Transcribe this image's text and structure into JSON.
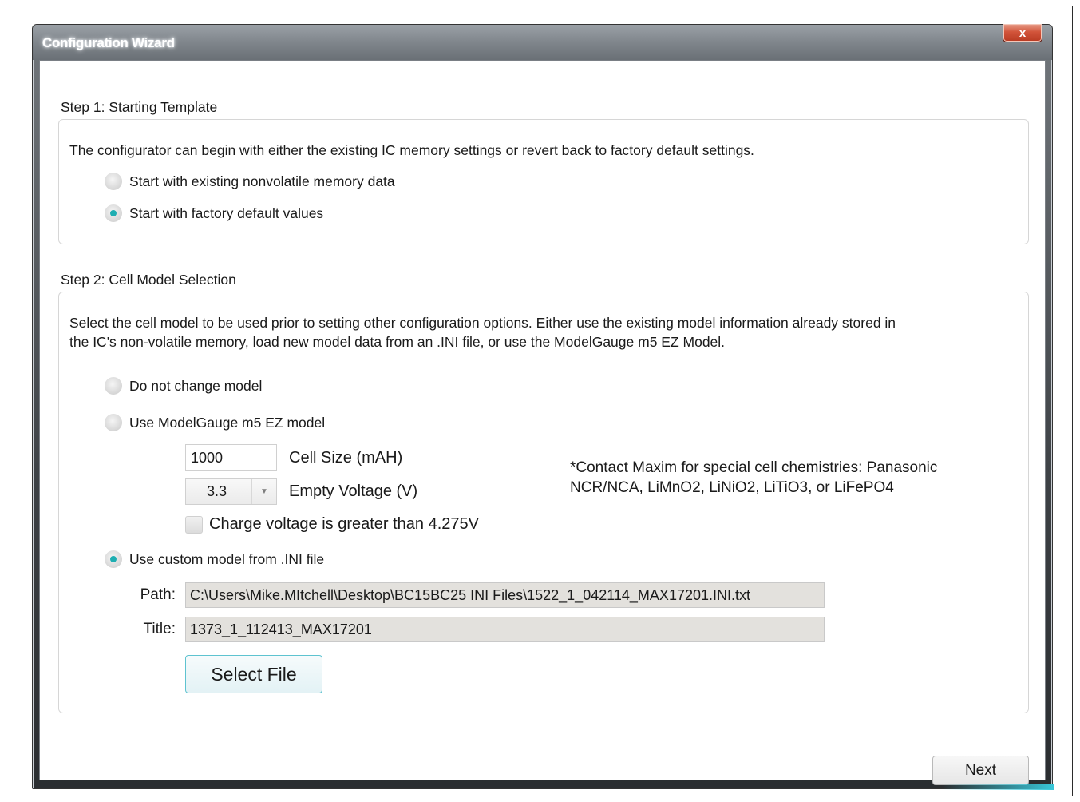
{
  "window": {
    "title": "Configuration Wizard",
    "close_symbol": "x"
  },
  "step1": {
    "label": "Step 1: Starting Template",
    "description": "The configurator can begin with either the existing IC memory settings or revert back to factory default settings.",
    "options": [
      {
        "label": "Start with existing nonvolatile memory data",
        "checked": false
      },
      {
        "label": "Start with factory default values",
        "checked": true
      }
    ]
  },
  "step2": {
    "label": "Step 2: Cell Model Selection",
    "description_line1": "Select the cell model to be used prior to setting other configuration options. Either use the existing model information already stored in",
    "description_line2": "the IC's non-volatile memory, load new model data from an .INI file, or use the ModelGauge m5 EZ Model.",
    "option_no_change": {
      "label": "Do not change model",
      "checked": false
    },
    "option_ez": {
      "label": "Use ModelGauge m5 EZ model",
      "checked": false
    },
    "cell_size": {
      "value": "1000",
      "label": "Cell Size (mAH)"
    },
    "empty_voltage": {
      "value": "3.3",
      "label": "Empty Voltage (V)"
    },
    "charge_voltage": {
      "label": "Charge voltage is greater than 4.275V",
      "checked": false
    },
    "note_line1": "*Contact Maxim for special cell chemistries: Panasonic",
    "note_line2": "NCR/NCA, LiMnO2, LiNiO2, LiTiO3, or LiFePO4",
    "option_custom": {
      "label": "Use custom model from .INI file",
      "checked": true
    },
    "path": {
      "label": "Path:",
      "value": "C:\\Users\\Mike.MItchell\\Desktop\\BC15BC25 INI Files\\1522_1_042114_MAX17201.INI.txt"
    },
    "title": {
      "label": "Title:",
      "value": "1373_1_112413_MAX17201"
    },
    "select_file_label": "Select File"
  },
  "footer": {
    "next_label": "Next"
  },
  "colors": {
    "accent": "#1eaeb2",
    "readonly_bg": "#e3e1dd",
    "close_red": "#c8452b"
  }
}
